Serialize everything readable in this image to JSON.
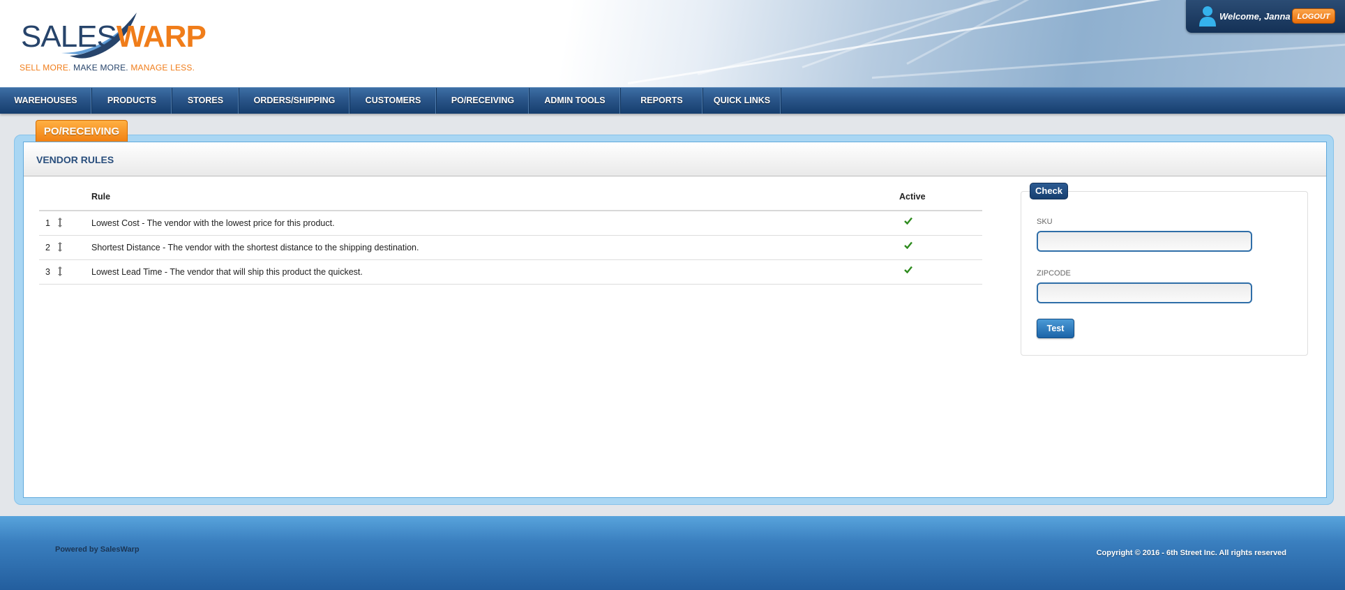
{
  "brand": {
    "name_part1": "SALES",
    "name_part2": "WARP",
    "tagline_part1": "SELL MORE. ",
    "tagline_part2": "MAKE MORE. ",
    "tagline_part3": "MANAGE LESS.",
    "primary_color": "#27446b",
    "accent_color": "#f07d1a"
  },
  "user": {
    "welcome": "Welcome, Janna",
    "logout_label": "LOGOUT",
    "icon": "user-icon"
  },
  "nav": {
    "items": [
      {
        "label": "WAREHOUSES"
      },
      {
        "label": "PRODUCTS"
      },
      {
        "label": "STORES"
      },
      {
        "label": "ORDERS/SHIPPING"
      },
      {
        "label": "CUSTOMERS"
      },
      {
        "label": "PO/RECEIVING"
      },
      {
        "label": "ADMIN TOOLS"
      },
      {
        "label": "REPORTS"
      },
      {
        "label": "QUICK LINKS"
      }
    ]
  },
  "page": {
    "section_tab": "PO/RECEIVING",
    "title": "VENDOR RULES"
  },
  "rules_table": {
    "headers": {
      "rule": "Rule",
      "active": "Active"
    },
    "rows": [
      {
        "index": "1",
        "rule": "Lowest Cost - The vendor with the lowest price for this product.",
        "active": true
      },
      {
        "index": "2",
        "rule": "Shortest Distance - The vendor with the shortest distance to the shipping destination.",
        "active": true
      },
      {
        "index": "3",
        "rule": "Lowest Lead Time - The vendor that will ship this product the quickest.",
        "active": true
      }
    ],
    "active_icon": "checkmark-icon",
    "drag_icon": "drag-handle-icon"
  },
  "check_panel": {
    "legend": "Check",
    "sku_label": "SKU",
    "sku_value": "",
    "zipcode_label": "ZIPCODE",
    "zipcode_value": "",
    "test_button": "Test"
  },
  "footer": {
    "powered_by": "Powered by SalesWarp",
    "copyright": "Copyright © 2016 - 6th Street Inc. All rights reserved"
  }
}
